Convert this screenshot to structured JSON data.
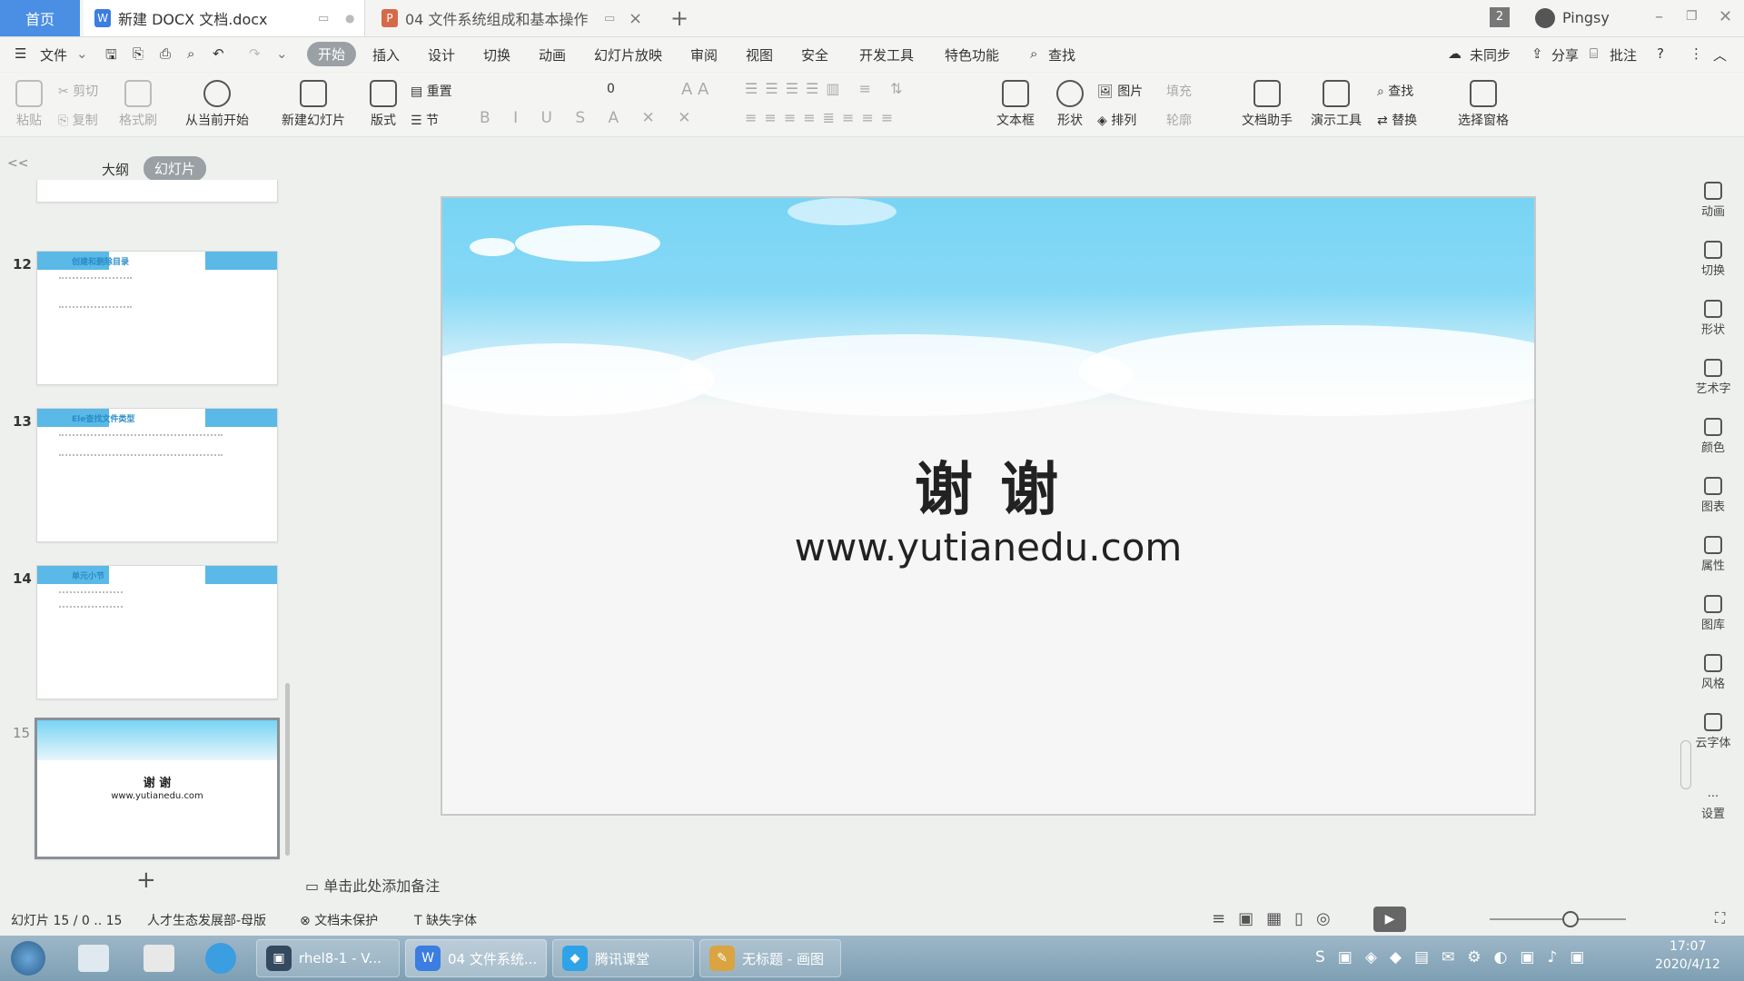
{
  "titlebar": {
    "home_tab": "首页",
    "doc_tab": "新建 DOCX 文档.docx",
    "ppt_tab": "04 文件系统组成和基本操作",
    "new_tab": "+",
    "badge": "2",
    "user": "Pingsy"
  },
  "menubar": {
    "file": "文件",
    "items": [
      "开始",
      "插入",
      "设计",
      "切换",
      "动画",
      "幻灯片放映",
      "审阅",
      "视图",
      "安全",
      "开发工具",
      "特色功能"
    ],
    "search": "查找",
    "sync": "未同步",
    "share": "分享",
    "comment": "批注"
  },
  "ribbon": {
    "paste": "粘贴",
    "cut": "剪切",
    "copy": "复制",
    "format_painter": "格式刷",
    "from_current": "从当前开始",
    "new_slide": "新建幻灯片",
    "layout": "版式",
    "reset": "重置",
    "section": "节",
    "font_size": "0",
    "textbox": "文本框",
    "shape": "形状",
    "picture": "图片",
    "fill": "填充",
    "arrange": "排列",
    "outline": "轮廓",
    "doc_helper": "文档助手",
    "present_tools": "演示工具",
    "find": "查找",
    "replace": "替换",
    "select_pane": "选择窗格"
  },
  "leftpanel": {
    "collapse": "<<",
    "tab_outline": "大纲",
    "tab_slides": "幻灯片",
    "slides": [
      {
        "num": "12",
        "title": "创建和删除目录"
      },
      {
        "num": "13",
        "title": "Ele查找文件类型"
      },
      {
        "num": "14",
        "title": "单元小节"
      },
      {
        "num": "15",
        "title": "谢 谢",
        "url": "www.yutianedu.com"
      }
    ],
    "add": "+"
  },
  "slide": {
    "title": "谢 谢",
    "url": "www.yutianedu.com"
  },
  "notes_placeholder": "单击此处添加备注",
  "rightbar": [
    "动画",
    "切换",
    "形状",
    "艺术字",
    "颜色",
    "图表",
    "属性",
    "图库",
    "风格",
    "云字体",
    "设置"
  ],
  "status": {
    "slide_info": "幻灯片 15 / 0 .. 15",
    "template": "人才生态发展部-母版",
    "protect": "文档未保护",
    "missing_font": "缺失字体"
  },
  "taskbar": {
    "items": [
      "rhel8-1 - V...",
      "04 文件系统...",
      "腾讯课堂",
      "无标题 - 画图"
    ],
    "time": "17:07",
    "date": "2020/4/12"
  },
  "colors": {
    "accent": "#4a8fe3",
    "sky": "#78d4f4",
    "active_menu": "#9aa0a4"
  }
}
